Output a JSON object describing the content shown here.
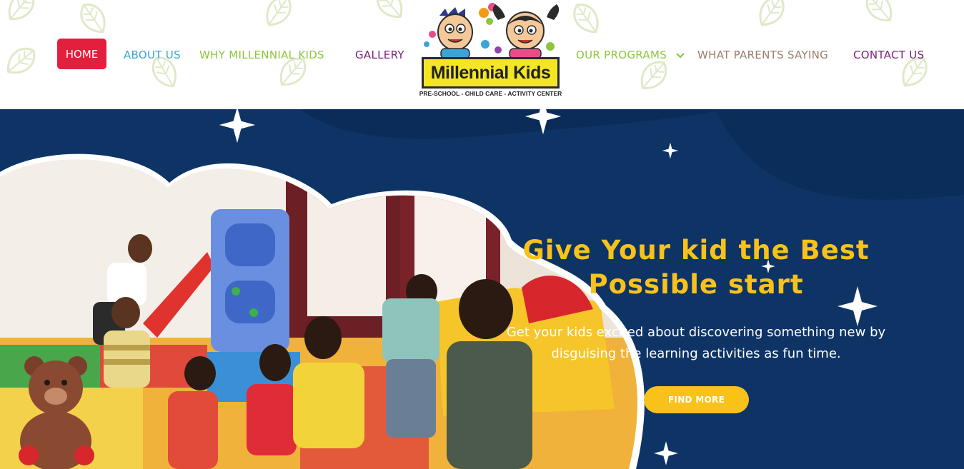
{
  "nav": {
    "items": [
      {
        "label": "HOME",
        "active": true
      },
      {
        "label": "ABOUT US",
        "color": "#3ba3d8"
      },
      {
        "label": "WHY MILLENNIAL KIDS",
        "color": "#8cc63f"
      },
      {
        "label": "GALLERY",
        "color": "#7a1e7a"
      },
      {
        "label": "OUR PROGRAMS",
        "color": "#8cc63f",
        "icon": "chevron-down-icon"
      },
      {
        "label": "WHAT PARENTS SAYING",
        "color": "#9a7d6b"
      },
      {
        "label": "CONTACT US",
        "color": "#7a1e7a"
      }
    ]
  },
  "logo": {
    "title": "Millennial Kids",
    "subtitle": "PRE-SCHOOL - CHILD CARE - ACTIVITY CENTER"
  },
  "hero": {
    "title_line1": "Give Your kid the Best",
    "title_line2": "Possible start",
    "text_line1": "Get your kids excited about discovering something new by",
    "text_line2": "disguising the learning activities as fun time.",
    "button_label": "FIND MORE",
    "image": "kids-playroom-photo"
  },
  "colors": {
    "brand_red": "#e21f3c",
    "hero_bg": "#0e3466",
    "accent_yellow": "#f9c21b"
  }
}
